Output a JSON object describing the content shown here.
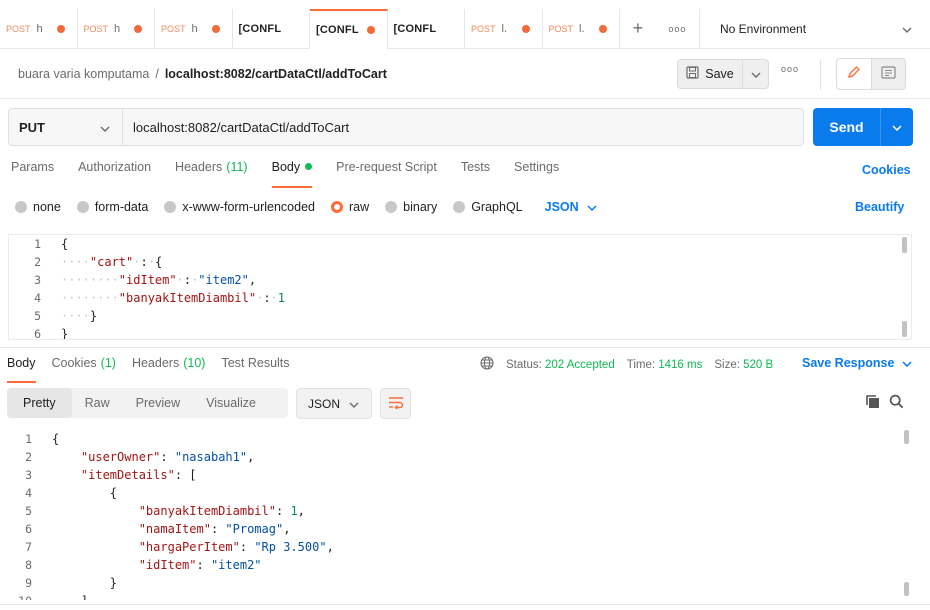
{
  "tabs": [
    {
      "method": "POST",
      "name": "h",
      "dot": true,
      "active": false
    },
    {
      "method": "POST",
      "name": "h",
      "dot": true,
      "active": false
    },
    {
      "method": "POST",
      "name": "h",
      "dot": true,
      "active": false
    },
    {
      "method": "",
      "name": "[CONFL",
      "dot": false,
      "active": false
    },
    {
      "method": "",
      "name": "[CONFL",
      "dot": true,
      "active": true
    },
    {
      "method": "",
      "name": "[CONFL",
      "dot": false,
      "active": false
    },
    {
      "method": "POST",
      "name": "l.",
      "dot": true,
      "active": false
    },
    {
      "method": "POST",
      "name": "l.",
      "dot": true,
      "active": false
    }
  ],
  "tab_actions": {
    "add": "+",
    "more": "ooo"
  },
  "environment": {
    "label": "No Environment"
  },
  "breadcrumb": {
    "collection": "buara varia komputama",
    "separator": "/",
    "request": "localhost:8082/cartDataCtl/addToCart"
  },
  "toolbar": {
    "save_label": "Save",
    "more": "ooo"
  },
  "request": {
    "method": "PUT",
    "url": "localhost:8082/cartDataCtl/addToCart",
    "send_label": "Send"
  },
  "request_tabs": [
    {
      "label": "Params",
      "count": "",
      "dot": false,
      "active": false
    },
    {
      "label": "Authorization",
      "count": "",
      "dot": false,
      "active": false
    },
    {
      "label": "Headers",
      "count": "(11)",
      "dot": false,
      "active": false
    },
    {
      "label": "Body",
      "count": "",
      "dot": true,
      "active": true
    },
    {
      "label": "Pre-request Script",
      "count": "",
      "dot": false,
      "active": false
    },
    {
      "label": "Tests",
      "count": "",
      "dot": false,
      "active": false
    },
    {
      "label": "Settings",
      "count": "",
      "dot": false,
      "active": false
    }
  ],
  "cookies_label": "Cookies",
  "body_types": [
    {
      "label": "none",
      "selected": false
    },
    {
      "label": "form-data",
      "selected": false
    },
    {
      "label": "x-www-form-urlencoded",
      "selected": false
    },
    {
      "label": "raw",
      "selected": true
    },
    {
      "label": "binary",
      "selected": false
    },
    {
      "label": "GraphQL",
      "selected": false
    }
  ],
  "body_format": "JSON",
  "beautify_label": "Beautify",
  "request_body_lines": [
    [
      {
        "t": "p",
        "v": "{"
      }
    ],
    [
      {
        "t": "ws",
        "v": "····"
      },
      {
        "t": "k",
        "v": "\"cart\""
      },
      {
        "t": "ws",
        "v": "·"
      },
      {
        "t": "p",
        "v": ":"
      },
      {
        "t": "ws",
        "v": "·"
      },
      {
        "t": "p",
        "v": "{"
      }
    ],
    [
      {
        "t": "ws",
        "v": "········"
      },
      {
        "t": "k",
        "v": "\"idItem\""
      },
      {
        "t": "ws",
        "v": "·"
      },
      {
        "t": "p",
        "v": ":"
      },
      {
        "t": "ws",
        "v": "·"
      },
      {
        "t": "s",
        "v": "\"item2\""
      },
      {
        "t": "p",
        "v": ","
      }
    ],
    [
      {
        "t": "ws",
        "v": "········"
      },
      {
        "t": "k",
        "v": "\"banyakItemDiambil\""
      },
      {
        "t": "ws",
        "v": "·"
      },
      {
        "t": "p",
        "v": ":"
      },
      {
        "t": "ws",
        "v": "·"
      },
      {
        "t": "n",
        "v": "1"
      }
    ],
    [
      {
        "t": "ws",
        "v": "····"
      },
      {
        "t": "p",
        "v": "}"
      }
    ],
    [
      {
        "t": "p",
        "v": "}"
      }
    ]
  ],
  "response_tabs": [
    {
      "label": "Body",
      "count": "",
      "active": true
    },
    {
      "label": "Cookies",
      "count": "(1)",
      "active": false
    },
    {
      "label": "Headers",
      "count": "(10)",
      "active": false
    },
    {
      "label": "Test Results",
      "count": "",
      "active": false
    }
  ],
  "response_meta": {
    "status_label": "Status:",
    "status_value": "202 Accepted",
    "time_label": "Time:",
    "time_value": "1416 ms",
    "size_label": "Size:",
    "size_value": "520 B"
  },
  "save_response_label": "Save Response",
  "view_modes": [
    {
      "label": "Pretty",
      "active": true
    },
    {
      "label": "Raw",
      "active": false
    },
    {
      "label": "Preview",
      "active": false
    },
    {
      "label": "Visualize",
      "active": false
    }
  ],
  "response_format": "JSON",
  "response_body_lines": [
    [
      {
        "t": "p",
        "v": "{"
      }
    ],
    [
      {
        "t": "p",
        "v": "    "
      },
      {
        "t": "k",
        "v": "\"userOwner\""
      },
      {
        "t": "p",
        "v": ": "
      },
      {
        "t": "s",
        "v": "\"nasabah1\""
      },
      {
        "t": "p",
        "v": ","
      }
    ],
    [
      {
        "t": "p",
        "v": "    "
      },
      {
        "t": "k",
        "v": "\"itemDetails\""
      },
      {
        "t": "p",
        "v": ": ["
      }
    ],
    [
      {
        "t": "p",
        "v": "        {"
      }
    ],
    [
      {
        "t": "p",
        "v": "            "
      },
      {
        "t": "k",
        "v": "\"banyakItemDiambil\""
      },
      {
        "t": "p",
        "v": ": "
      },
      {
        "t": "n",
        "v": "1"
      },
      {
        "t": "p",
        "v": ","
      }
    ],
    [
      {
        "t": "p",
        "v": "            "
      },
      {
        "t": "k",
        "v": "\"namaItem\""
      },
      {
        "t": "p",
        "v": ": "
      },
      {
        "t": "s",
        "v": "\"Promag\""
      },
      {
        "t": "p",
        "v": ","
      }
    ],
    [
      {
        "t": "p",
        "v": "            "
      },
      {
        "t": "k",
        "v": "\"hargaPerItem\""
      },
      {
        "t": "p",
        "v": ": "
      },
      {
        "t": "s",
        "v": "\"Rp 3.500\""
      },
      {
        "t": "p",
        "v": ","
      }
    ],
    [
      {
        "t": "p",
        "v": "            "
      },
      {
        "t": "k",
        "v": "\"idItem\""
      },
      {
        "t": "p",
        "v": ": "
      },
      {
        "t": "s",
        "v": "\"item2\""
      }
    ],
    [
      {
        "t": "p",
        "v": "        }"
      }
    ],
    [
      {
        "t": "p",
        "v": "    ]"
      }
    ]
  ],
  "colors": {
    "accent": "#ff6c37",
    "primary": "#097bed",
    "success": "#0cbb52"
  }
}
